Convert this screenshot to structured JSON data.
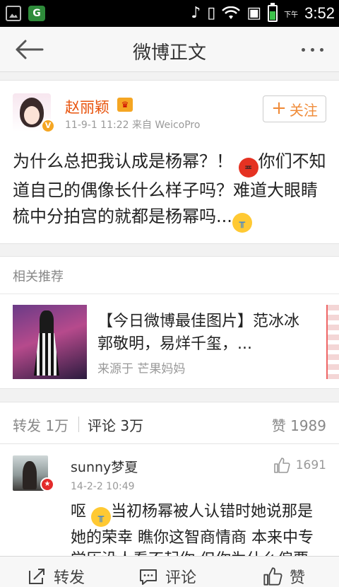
{
  "status_bar": {
    "ampm": "下午",
    "time": "3:52"
  },
  "header": {
    "title": "微博正文"
  },
  "post": {
    "author": "赵丽颖",
    "meta": "11-9-1 11:22  来自 WeicoPro",
    "follow_label": "关注",
    "text_part1": "为什么总把我认成是杨幂？！",
    "text_part2": "你们不知道自己的偶像长什么样子吗？难道大眼睛梳中分拍宫的就都是杨幂吗...",
    "verified_badge": "V"
  },
  "related": {
    "section_title": "相关推荐",
    "item_title": "【今日微博最佳图片】范冰冰郭敬明，易烊千玺，...",
    "item_source": "来源于 芒果妈妈"
  },
  "tabs": {
    "repost": "转发 1万",
    "comments": "评论 3万",
    "likes": "赞 1989"
  },
  "comment": {
    "user": "sunny梦夏",
    "time": "14-2-2 10:49",
    "likes": "1691",
    "text_part1": "呕",
    "text_part2": "当初杨幂被人认错时她说那是她的荣幸 瞧你这智商情商 本来中专学历没人看不起你 但你为什么偏要"
  },
  "bottom_bar": {
    "repost": "转发",
    "comment": "评论",
    "like": "赞"
  },
  "icons": {
    "back": "arrow-left-icon",
    "more": "more-dots-icon",
    "thumb": "thumbs-up-icon"
  },
  "colors": {
    "accent": "#e8540e",
    "follow": "#f08c3a"
  }
}
